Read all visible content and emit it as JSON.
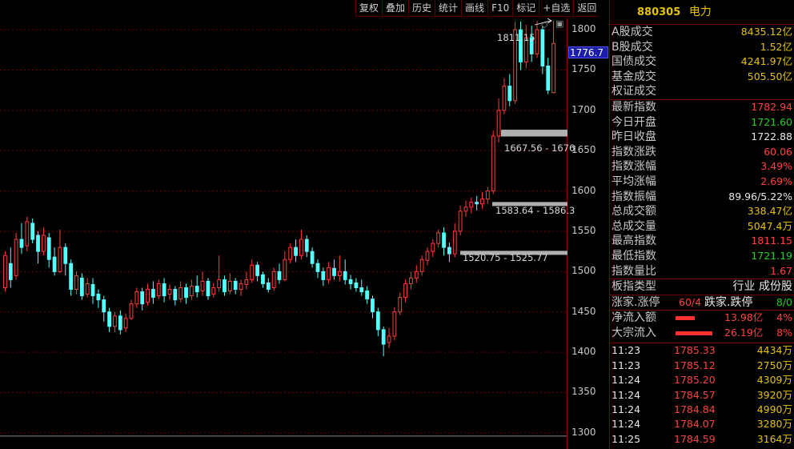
{
  "toolbar": {
    "buttons": [
      "复权",
      "叠加",
      "历史",
      "统计",
      "画线",
      "F10",
      "标记",
      "+自选",
      "返回"
    ]
  },
  "chart": {
    "y_ticks": [
      "1800",
      "1750",
      "1700",
      "1650",
      "1600",
      "1550",
      "1500",
      "1450",
      "1400",
      "1350",
      "1300"
    ],
    "current_price": "1776.7",
    "high_label": "1811.15",
    "range_labels": {
      "top": "1667.56 - 1676",
      "mid": "1583.64 - 1586.3",
      "low": "1520.75 - 1525.77"
    },
    "colors": {
      "up": "#ff3c3c",
      "down": "#54ffff",
      "grid": "#6e0000"
    }
  },
  "chart_data": {
    "type": "candlestick",
    "ylim": [
      1280,
      1815
    ],
    "candles": [
      [
        1480,
        1520,
        1475,
        1525
      ],
      [
        1510,
        1490,
        1480,
        1530
      ],
      [
        1495,
        1540,
        1490,
        1548
      ],
      [
        1540,
        1530,
        1522,
        1560
      ],
      [
        1532,
        1562,
        1525,
        1568
      ],
      [
        1560,
        1540,
        1535,
        1566
      ],
      [
        1545,
        1525,
        1510,
        1550
      ],
      [
        1525,
        1545,
        1520,
        1555
      ],
      [
        1542,
        1515,
        1505,
        1548
      ],
      [
        1518,
        1500,
        1495,
        1530
      ],
      [
        1500,
        1530,
        1498,
        1552
      ],
      [
        1530,
        1510,
        1495,
        1535
      ],
      [
        1510,
        1478,
        1470,
        1515
      ],
      [
        1478,
        1495,
        1472,
        1500
      ],
      [
        1492,
        1470,
        1465,
        1498
      ],
      [
        1472,
        1485,
        1468,
        1492
      ],
      [
        1484,
        1470,
        1460,
        1492
      ],
      [
        1472,
        1465,
        1455,
        1478
      ],
      [
        1465,
        1450,
        1438,
        1470
      ],
      [
        1450,
        1432,
        1425,
        1455
      ],
      [
        1432,
        1445,
        1425,
        1450
      ],
      [
        1445,
        1428,
        1422,
        1452
      ],
      [
        1430,
        1442,
        1425,
        1448
      ],
      [
        1442,
        1460,
        1440,
        1465
      ],
      [
        1460,
        1475,
        1455,
        1480
      ],
      [
        1475,
        1460,
        1452,
        1480
      ],
      [
        1462,
        1478,
        1458,
        1485
      ],
      [
        1478,
        1468,
        1460,
        1488
      ],
      [
        1470,
        1485,
        1466,
        1490
      ],
      [
        1485,
        1470,
        1462,
        1492
      ],
      [
        1472,
        1478,
        1465,
        1484
      ],
      [
        1478,
        1465,
        1458,
        1482
      ],
      [
        1466,
        1480,
        1462,
        1488
      ],
      [
        1480,
        1468,
        1460,
        1485
      ],
      [
        1470,
        1482,
        1465,
        1490
      ],
      [
        1482,
        1475,
        1468,
        1495
      ],
      [
        1476,
        1488,
        1470,
        1500
      ],
      [
        1488,
        1470,
        1465,
        1492
      ],
      [
        1472,
        1480,
        1468,
        1486
      ],
      [
        1480,
        1490,
        1475,
        1520
      ],
      [
        1490,
        1475,
        1470,
        1495
      ],
      [
        1476,
        1488,
        1472,
        1498
      ],
      [
        1488,
        1478,
        1472,
        1492
      ],
      [
        1478,
        1485,
        1470,
        1490
      ],
      [
        1484,
        1490,
        1478,
        1500
      ],
      [
        1490,
        1508,
        1486,
        1515
      ],
      [
        1508,
        1495,
        1488,
        1512
      ],
      [
        1496,
        1485,
        1480,
        1500
      ],
      [
        1486,
        1478,
        1474,
        1492
      ],
      [
        1480,
        1500,
        1476,
        1505
      ],
      [
        1500,
        1490,
        1485,
        1510
      ],
      [
        1490,
        1515,
        1488,
        1525
      ],
      [
        1515,
        1530,
        1510,
        1535
      ],
      [
        1530,
        1520,
        1512,
        1540
      ],
      [
        1520,
        1540,
        1515,
        1552
      ],
      [
        1540,
        1525,
        1518,
        1545
      ],
      [
        1525,
        1510,
        1505,
        1530
      ],
      [
        1510,
        1500,
        1492,
        1515
      ],
      [
        1500,
        1490,
        1482,
        1505
      ],
      [
        1490,
        1505,
        1485,
        1512
      ],
      [
        1504,
        1495,
        1490,
        1515
      ],
      [
        1495,
        1500,
        1488,
        1520
      ],
      [
        1500,
        1490,
        1484,
        1515
      ],
      [
        1490,
        1485,
        1478,
        1496
      ],
      [
        1486,
        1480,
        1475,
        1492
      ],
      [
        1480,
        1475,
        1470,
        1490
      ],
      [
        1476,
        1466,
        1460,
        1482
      ],
      [
        1466,
        1450,
        1442,
        1470
      ],
      [
        1450,
        1428,
        1420,
        1455
      ],
      [
        1428,
        1410,
        1395,
        1432
      ],
      [
        1412,
        1420,
        1405,
        1430
      ],
      [
        1420,
        1450,
        1415,
        1456
      ],
      [
        1450,
        1468,
        1446,
        1474
      ],
      [
        1468,
        1485,
        1462,
        1490
      ],
      [
        1485,
        1492,
        1478,
        1500
      ],
      [
        1492,
        1500,
        1486,
        1508
      ],
      [
        1500,
        1515,
        1495,
        1520
      ],
      [
        1514,
        1525,
        1508,
        1530
      ],
      [
        1525,
        1535,
        1518,
        1540
      ],
      [
        1535,
        1548,
        1530,
        1552
      ],
      [
        1548,
        1530,
        1520,
        1555
      ],
      [
        1530,
        1522,
        1512,
        1536
      ],
      [
        1522,
        1550,
        1518,
        1560
      ],
      [
        1550,
        1575,
        1545,
        1582
      ],
      [
        1575,
        1580,
        1568,
        1588
      ],
      [
        1580,
        1586,
        1572,
        1592
      ],
      [
        1586,
        1584,
        1576,
        1594
      ],
      [
        1584,
        1590,
        1578,
        1598
      ],
      [
        1590,
        1600,
        1584,
        1605
      ],
      [
        1600,
        1668,
        1596,
        1675
      ],
      [
        1668,
        1700,
        1660,
        1715
      ],
      [
        1700,
        1730,
        1695,
        1740
      ],
      [
        1730,
        1712,
        1705,
        1745
      ],
      [
        1712,
        1800,
        1708,
        1810
      ],
      [
        1800,
        1760,
        1750,
        1810
      ],
      [
        1760,
        1790,
        1752,
        1806
      ],
      [
        1790,
        1770,
        1760,
        1805
      ],
      [
        1770,
        1800,
        1765,
        1811
      ],
      [
        1800,
        1755,
        1745,
        1805
      ],
      [
        1755,
        1725,
        1720,
        1765
      ],
      [
        1722,
        1783,
        1721,
        1811
      ]
    ]
  },
  "panel": {
    "code": "880305",
    "name": "电力",
    "volume_rows": [
      {
        "label": "A股成交",
        "value": "8435.12亿",
        "color": "yellow"
      },
      {
        "label": "B股成交",
        "value": "1.52亿",
        "color": "yellow"
      },
      {
        "label": "国债成交",
        "value": "4241.97亿",
        "color": "yellow"
      },
      {
        "label": "基金成交",
        "value": "505.50亿",
        "color": "yellow"
      },
      {
        "label": "权证成交",
        "value": "",
        "color": "yellow"
      }
    ],
    "index_rows": [
      {
        "label": "最新指数",
        "value": "1782.94",
        "color": "red"
      },
      {
        "label": "今日开盘",
        "value": "1721.60",
        "color": "green"
      },
      {
        "label": "昨日收盘",
        "value": "1722.88",
        "color": "white"
      },
      {
        "label": "指数涨跌",
        "value": "60.06",
        "color": "red"
      },
      {
        "label": "指数涨幅",
        "value": "3.49%",
        "color": "red"
      },
      {
        "label": "平均涨幅",
        "value": "2.69%",
        "color": "red"
      },
      {
        "label": "指数振幅",
        "value": "89.96/5.22%",
        "color": "white"
      },
      {
        "label": "总成交额",
        "value": "338.47亿",
        "color": "yellow"
      },
      {
        "label": "总成交量",
        "value": "5047.4万",
        "color": "yellow"
      },
      {
        "label": "最高指数",
        "value": "1811.15",
        "color": "red"
      },
      {
        "label": "最低指数",
        "value": "1721.19",
        "color": "green"
      },
      {
        "label": "指数量比",
        "value": "1.67",
        "color": "red"
      }
    ],
    "sector_type_label": "板指类型",
    "sector_type_value": "行业 成份股",
    "rise_label": "涨家.涨停",
    "rise_value": "60/4",
    "fall_label": "跌家.跌停",
    "fall_value": "8/0",
    "net_inflow_label": "净流入额",
    "net_inflow_value": "13.98亿",
    "net_inflow_pct": "4%",
    "block_inflow_label": "大宗流入",
    "block_inflow_value": "26.19亿",
    "block_inflow_pct": "8%",
    "ticks": [
      {
        "time": "11:23",
        "price": "1785.33",
        "vol": "4434万"
      },
      {
        "time": "11:23",
        "price": "1785.12",
        "vol": "2750万"
      },
      {
        "time": "11:24",
        "price": "1785.20",
        "vol": "4309万"
      },
      {
        "time": "11:24",
        "price": "1784.57",
        "vol": "3920万"
      },
      {
        "time": "11:24",
        "price": "1784.84",
        "vol": "4990万"
      },
      {
        "time": "11:24",
        "price": "1784.07",
        "vol": "3280万"
      },
      {
        "time": "11:25",
        "price": "1784.59",
        "vol": "3164万"
      }
    ]
  }
}
